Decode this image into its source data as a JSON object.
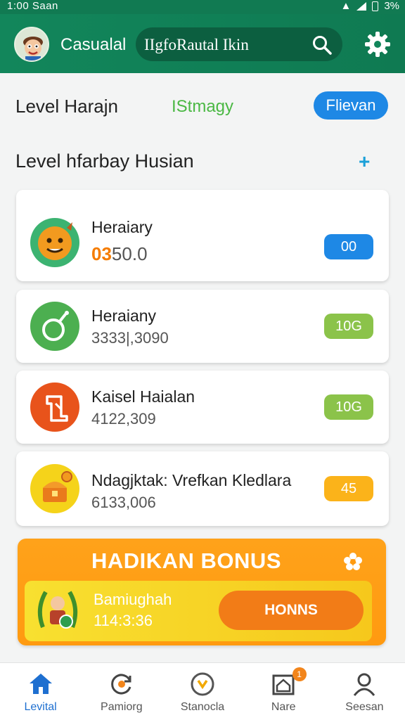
{
  "status_bar": {
    "time": "1:00 Saan",
    "battery": "3%"
  },
  "app_bar": {
    "title": "Casualal",
    "search_value": "IIgfoRautal Ikin"
  },
  "filter_row": {
    "label": "Level Harajn",
    "strategy": "IStmagy",
    "button": "Flievan"
  },
  "section": {
    "title": "Level hfarbay Husian",
    "add_symbol": "+"
  },
  "cards": [
    {
      "name": "Heraiary",
      "value_accent": "03",
      "value_rest": "50.0",
      "badge": "00",
      "badge_color": "#1e88e5",
      "icon_bg": "#3cb371"
    },
    {
      "name": "Heraiany",
      "value": "3333|,3090",
      "badge": "10G",
      "badge_color": "#8bc34a",
      "icon_bg": "#4caf50"
    },
    {
      "name": "Kaisel Haialan",
      "value": "4122,309",
      "badge": "10G",
      "badge_color": "#8bc34a",
      "icon_bg": "#e8531b"
    },
    {
      "name": "Ndagjktak: Vrefkan Kledlara",
      "value": "6133,006",
      "badge": "45",
      "badge_color": "#fbb31a",
      "icon_bg": "#f5d31a"
    }
  ],
  "bonus": {
    "title": "HADIKAN BONUS",
    "subtitle": "Bamiughah",
    "number": "114:3:36",
    "cta": "HONNS"
  },
  "bottom_nav": [
    {
      "label": "Levital",
      "icon": "home-icon",
      "active": true
    },
    {
      "label": "Pamiorg",
      "icon": "refresh-icon",
      "active": false
    },
    {
      "label": "Stanocla",
      "icon": "compass-icon",
      "active": false
    },
    {
      "label": "Nare",
      "icon": "house-icon",
      "active": false,
      "badge": "1"
    },
    {
      "label": "Seesan",
      "icon": "profile-icon",
      "active": false
    }
  ],
  "colors": {
    "primary": "#12865b",
    "accent_blue": "#1e88e5",
    "bonus": "#ff9a10"
  }
}
